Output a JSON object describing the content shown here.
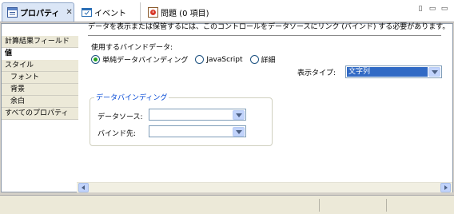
{
  "tabs": [
    {
      "label": "プロパティ",
      "close": "✕",
      "icon": "properties-icon"
    },
    {
      "label": "イベント",
      "icon": "events-icon"
    },
    {
      "label": "問題 (0 項目)",
      "icon": "problems-icon"
    }
  ],
  "window_controls": {
    "menu": "▯",
    "minimize": "▭",
    "maximize": "▭"
  },
  "nav": [
    {
      "label": "計算結果フィールド"
    },
    {
      "label": "値"
    },
    {
      "label": "スタイル"
    },
    {
      "label": "フォント"
    },
    {
      "label": "背景"
    },
    {
      "label": "余白"
    },
    {
      "label": "すべてのプロパティ"
    }
  ],
  "content": {
    "description": "データを表示または保管するには、このコントロールをデータソースにリンク (バインド) する必要があります。",
    "bind_label": "使用するバインドデータ:",
    "radios": [
      {
        "label": "単純データバインディング",
        "checked": true
      },
      {
        "label": "JavaScript",
        "checked": false
      },
      {
        "label": "詳細",
        "checked": false
      }
    ],
    "display_type_label": "表示タイプ:",
    "display_type_value": "文字列",
    "group_title": "データバインディング",
    "datasource_label": "データソース:",
    "datasource_value": "",
    "bindto_label": "バインド先:",
    "bindto_value": ""
  },
  "colors": {
    "accent": "#316ac5",
    "group_title": "#0046d5",
    "radio_checked": "#21a121"
  }
}
